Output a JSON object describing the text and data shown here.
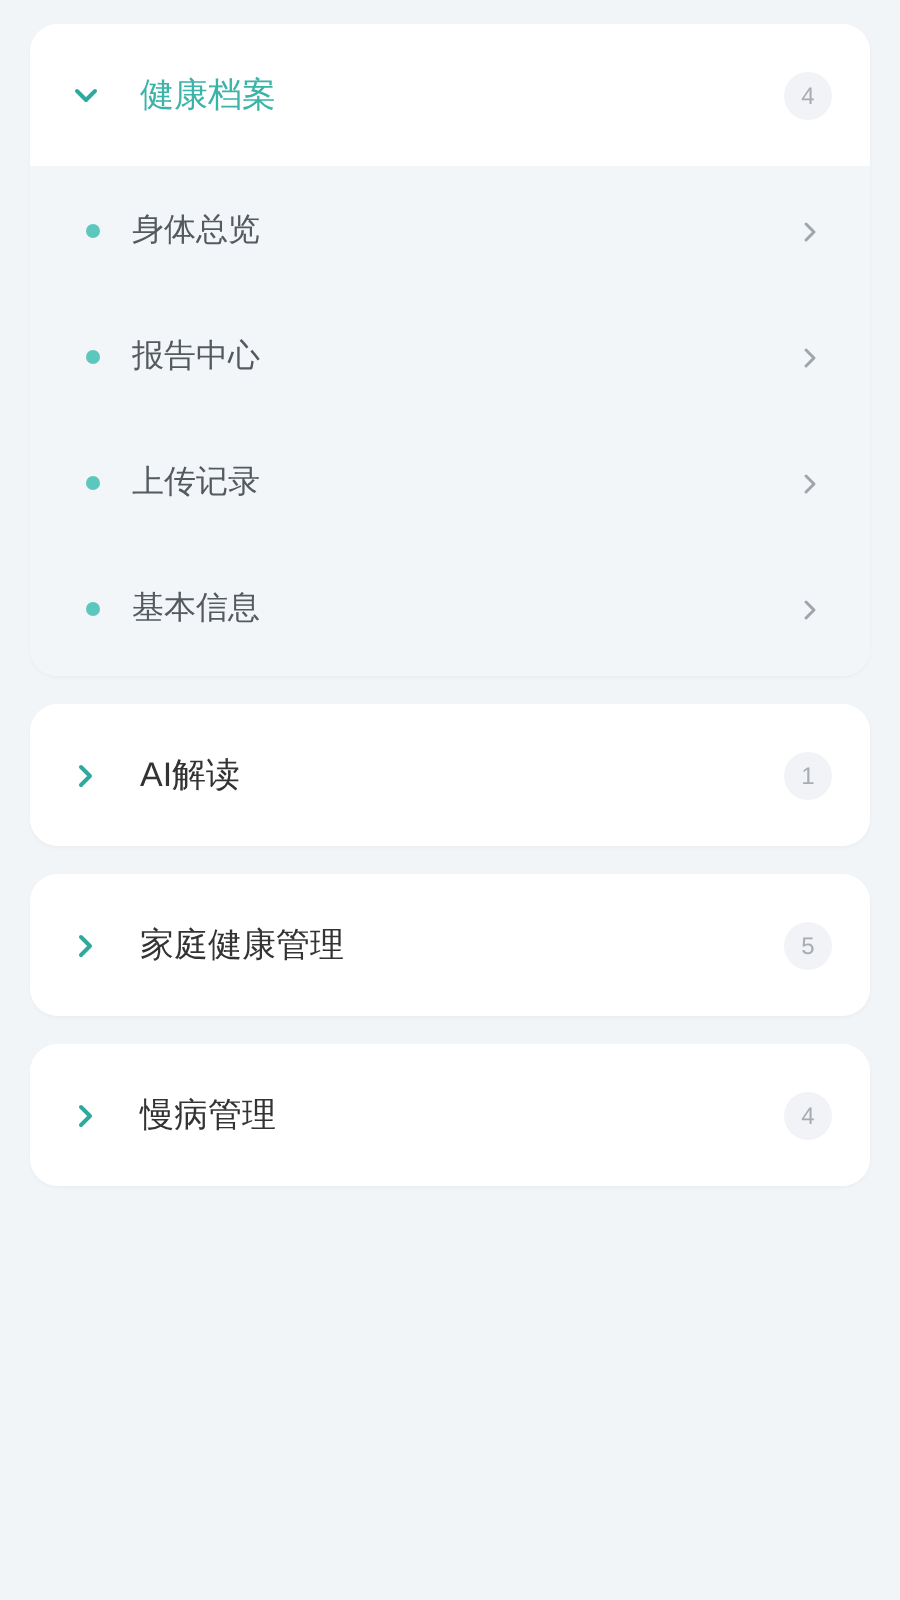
{
  "sections": [
    {
      "title": "健康档案",
      "count": "4",
      "expanded": true,
      "items": [
        {
          "label": "身体总览"
        },
        {
          "label": "报告中心"
        },
        {
          "label": "上传记录"
        },
        {
          "label": "基本信息"
        }
      ]
    },
    {
      "title": "AI解读",
      "count": "1",
      "expanded": false
    },
    {
      "title": "家庭健康管理",
      "count": "5",
      "expanded": false
    },
    {
      "title": "慢病管理",
      "count": "4",
      "expanded": false
    }
  ]
}
